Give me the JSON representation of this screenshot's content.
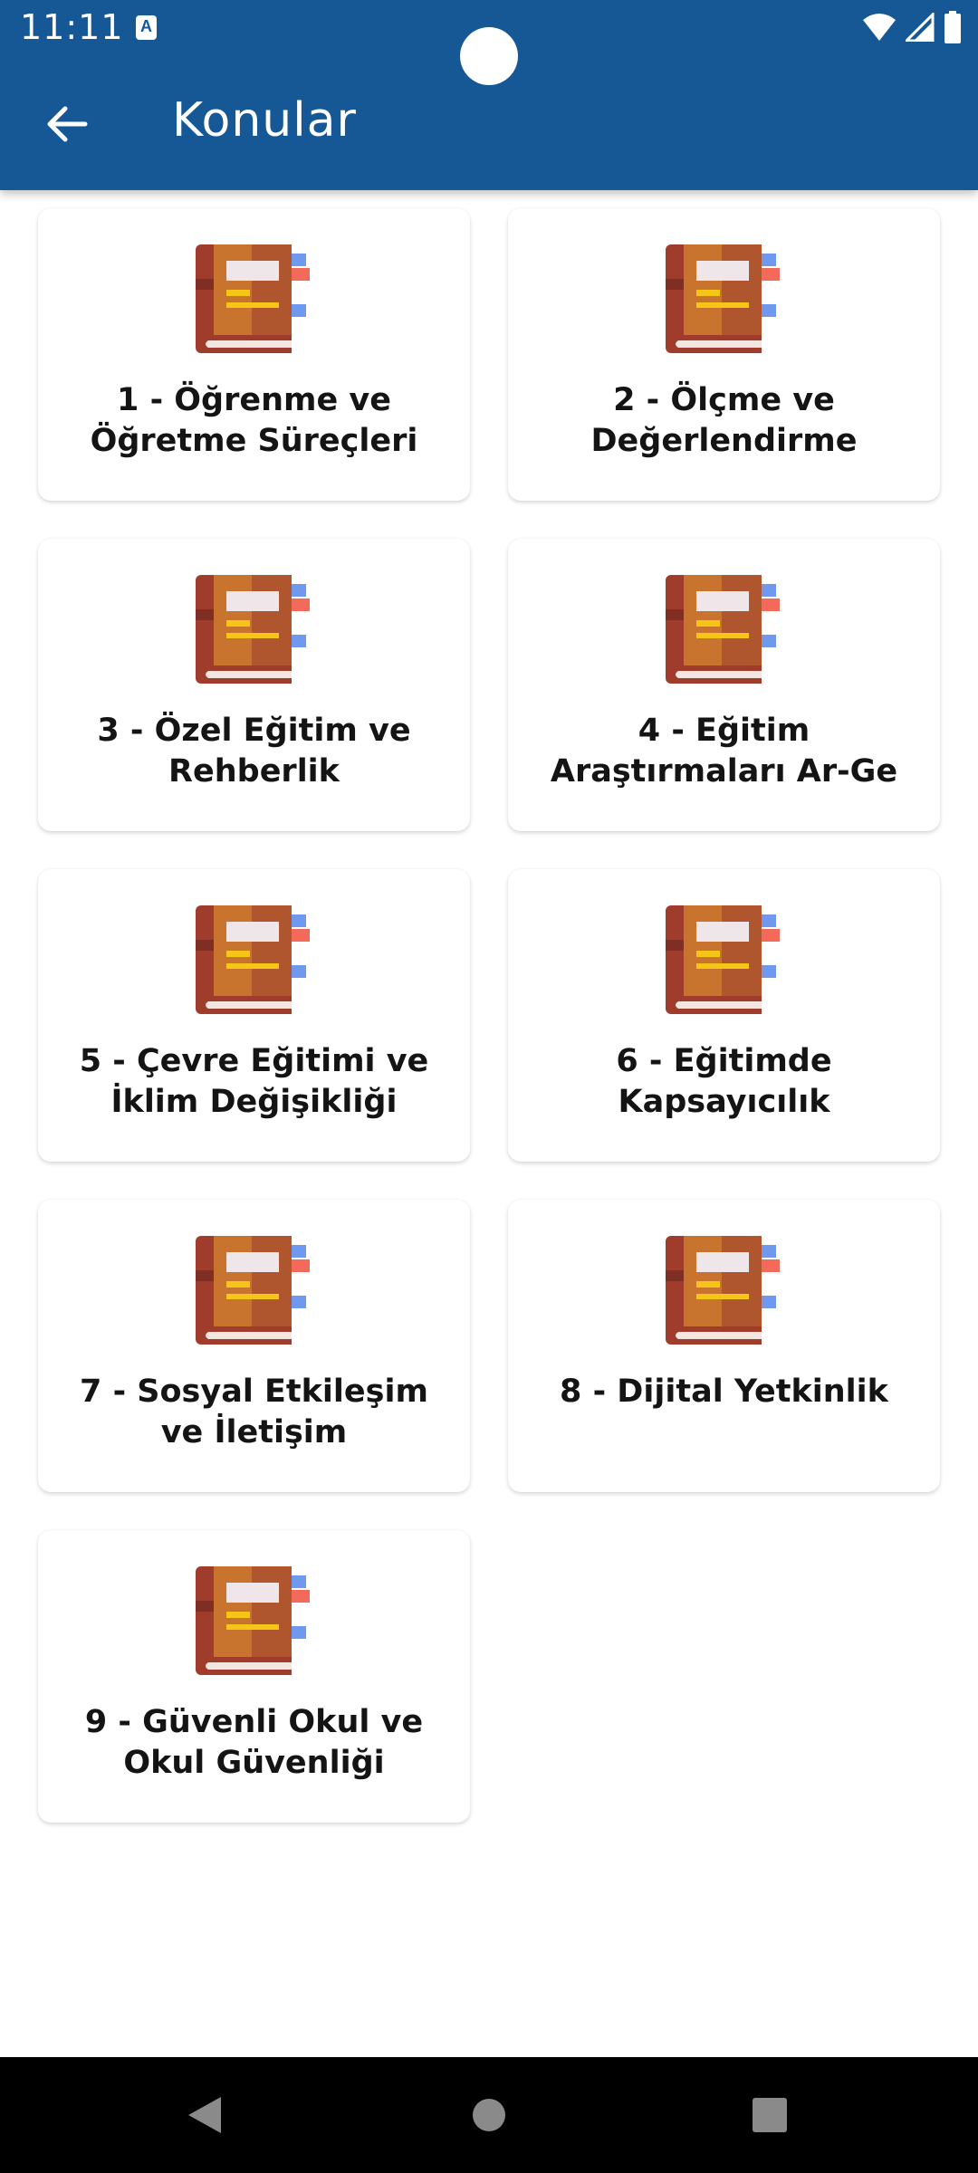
{
  "status_bar": {
    "time": "11:11",
    "notification_badge": "A"
  },
  "toolbar": {
    "title": "Konular",
    "back_icon": "arrow-left-icon"
  },
  "topics": [
    {
      "title": "1 - Öğrenme ve Öğretme Süreçleri",
      "icon": "book-icon"
    },
    {
      "title": "2 - Ölçme ve Değerlendirme",
      "icon": "book-icon"
    },
    {
      "title": "3 - Özel Eğitim ve Rehberlik",
      "icon": "book-icon"
    },
    {
      "title": "4 - Eğitim Araştırmaları Ar-Ge",
      "icon": "book-icon"
    },
    {
      "title": "5 - Çevre Eğitimi ve İklim Değişikliği",
      "icon": "book-icon"
    },
    {
      "title": "6 - Eğitimde Kapsayıcılık",
      "icon": "book-icon"
    },
    {
      "title": "7 - Sosyal Etkileşim ve İletişim",
      "icon": "book-icon"
    },
    {
      "title": "8 - Dijital Yetkinlik",
      "icon": "book-icon"
    },
    {
      "title": "9 - Güvenli Okul ve Okul Güvenliği",
      "icon": "book-icon"
    }
  ],
  "colors": {
    "app_bar": "#155895",
    "card_background": "#ffffff",
    "text": "#141414",
    "book_cover": "#c0763a",
    "book_spine": "#a04030"
  },
  "nav_bar": {
    "back_icon": "triangle-back-icon",
    "home_icon": "circle-home-icon",
    "recents_icon": "square-recents-icon"
  }
}
